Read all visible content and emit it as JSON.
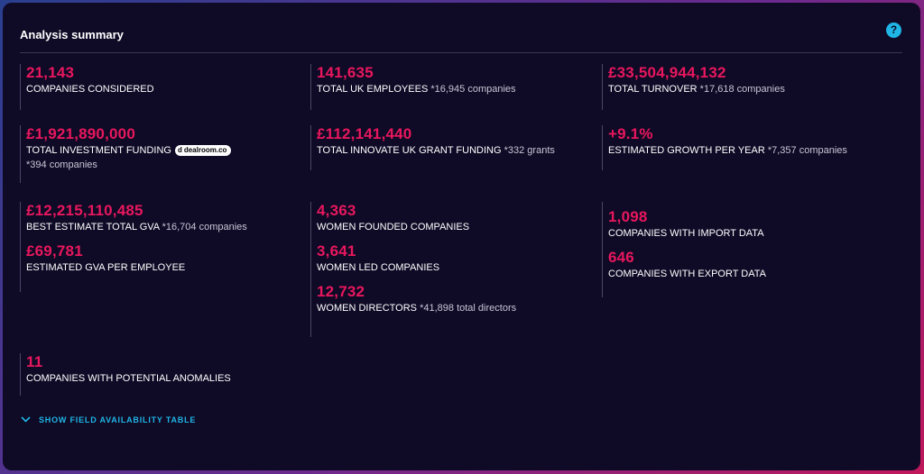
{
  "header": {
    "title": "Analysis summary",
    "help_icon": "?"
  },
  "col1": {
    "b1": {
      "value": "21,143",
      "label": "COMPANIES CONSIDERED"
    },
    "b2": {
      "value": "£1,921,890,000",
      "label": "TOTAL INVESTMENT FUNDING",
      "badge": "dealroom.co",
      "badge_icon": "d",
      "note": "*394 companies"
    },
    "b3": {
      "value": "£12,215,110,485",
      "label": "BEST ESTIMATE TOTAL GVA",
      "note": "*16,704 companies",
      "value2": "£69,781",
      "label2": "ESTIMATED GVA PER EMPLOYEE"
    },
    "b4": {
      "value": "11",
      "label": "COMPANIES WITH POTENTIAL ANOMALIES"
    }
  },
  "col2": {
    "b1": {
      "value": "141,635",
      "label": "TOTAL UK EMPLOYEES",
      "note": "*16,945 companies"
    },
    "b2": {
      "value": "£112,141,440",
      "label": "TOTAL INNOVATE UK GRANT FUNDING",
      "note": "*332 grants"
    },
    "b3": {
      "value1": "4,363",
      "label1": "WOMEN FOUNDED COMPANIES",
      "value2": "3,641",
      "label2": "WOMEN LED COMPANIES",
      "value3": "12,732",
      "label3": "WOMEN DIRECTORS",
      "note3": "*41,898 total directors"
    }
  },
  "col3": {
    "b1": {
      "value": "£33,504,944,132",
      "label": "TOTAL TURNOVER",
      "note": "*17,618 companies"
    },
    "b2": {
      "value": "+9.1%",
      "label": "ESTIMATED GROWTH PER YEAR",
      "note": "*7,357 companies"
    },
    "b3": {
      "value1": "1,098",
      "label1": "COMPANIES WITH IMPORT DATA",
      "value2": "646",
      "label2": "COMPANIES WITH EXPORT DATA"
    }
  },
  "footer": {
    "toggle_label": "SHOW FIELD AVAILABILITY TABLE"
  },
  "colors": {
    "accent": "#e8175d",
    "link": "#1fb6e6",
    "background": "#0f0a26"
  }
}
